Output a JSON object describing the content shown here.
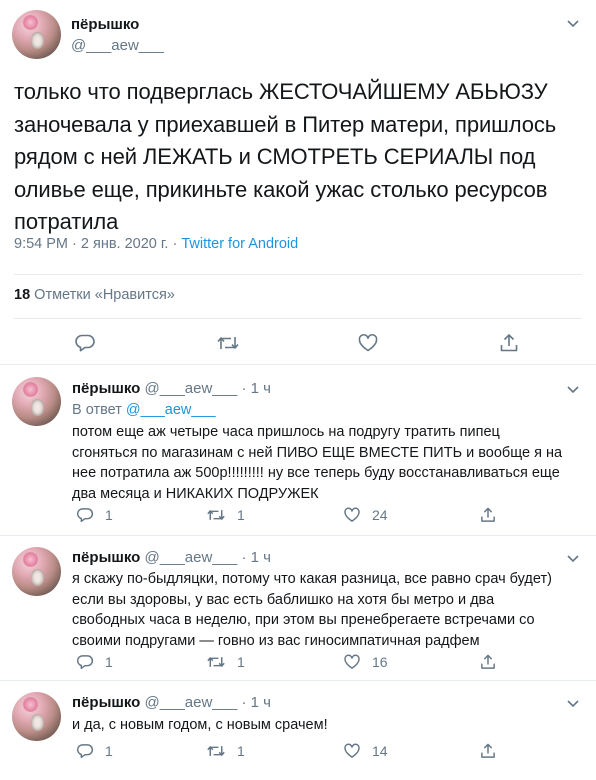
{
  "main": {
    "name": "пёрышко",
    "handle": "@___aew___",
    "text": "только что подверглась ЖЕСТОЧАЙШЕМУ АБЬЮЗУ\nзаночевала у приехавшей в Питер матери, пришлось\nрядом с ней ЛЕЖАТЬ и СМОТРЕТЬ СЕРИАЛЫ под\nоливье еще, прикиньте какой ужас столько ресурсов\nпотратила",
    "time": "9:54 PM · 2 янв. 2020 г. · ",
    "source": "Twitter for Android",
    "likes_count": "18",
    "likes_label": " Отметки «Нравится»"
  },
  "replies": [
    {
      "name": "пёрышко",
      "handle": "@___aew___",
      "time": " · 1 ч",
      "in_reply_label": "В ответ ",
      "in_reply_handle": "@___aew___",
      "text": "потом еще аж четыре часа пришлось на подругу тратить пипец\nсгоняться по магазинам с ней ПИВО ЕЩЕ ВМЕСТЕ ПИТЬ и вообще я на\nнее потратила аж 500р!!!!!!!!! ну все теперь буду восстанавливаться еще\nдва месяца и НИКАКИХ ПОДРУЖЕК",
      "replies": "1",
      "retweets": "1",
      "likes": "24"
    },
    {
      "name": "пёрышко",
      "handle": "@___aew___",
      "time": " · 1 ч",
      "text": "я скажу по-быдляцки, потому что какая разница, все равно срач будет)\nесли вы здоровы, у вас есть баблишко на хотя бы метро и два\nсвободных часа в неделю, при этом вы пренебрегаете встречами со\nсвоими подругами — говно из вас гиносимпатичная радфем",
      "replies": "1",
      "retweets": "1",
      "likes": "16"
    },
    {
      "name": "пёрышко",
      "handle": "@___aew___",
      "time": " · 1 ч",
      "text": "и да, с новым годом, с новым срачем!",
      "replies": "1",
      "retweets": "1",
      "likes": "14"
    }
  ]
}
